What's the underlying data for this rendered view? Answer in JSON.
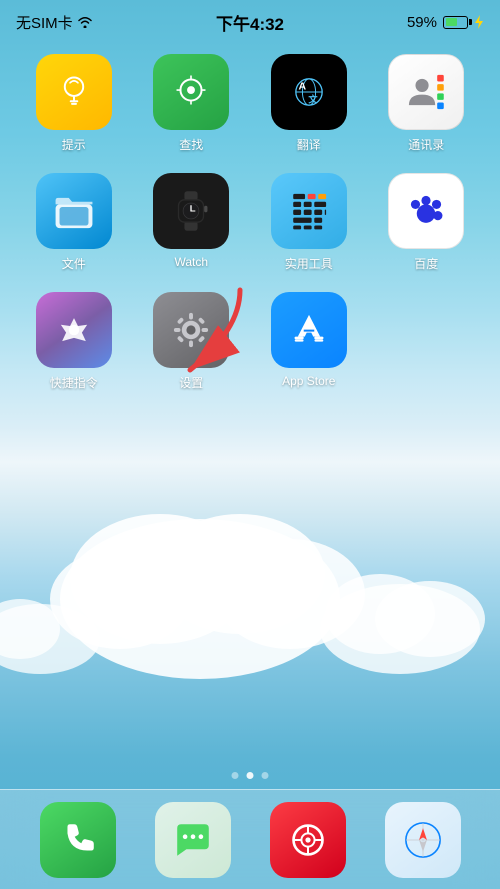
{
  "statusBar": {
    "carrier": "无SIM卡",
    "time": "下午4:32",
    "battery": "59%",
    "batteryCharging": true
  },
  "apps": [
    {
      "id": "tips",
      "label": "提示",
      "iconClass": "icon-tips"
    },
    {
      "id": "find",
      "label": "查找",
      "iconClass": "icon-find"
    },
    {
      "id": "translate",
      "label": "翻译",
      "iconClass": "icon-translate"
    },
    {
      "id": "contacts",
      "label": "通讯录",
      "iconClass": "icon-contacts"
    },
    {
      "id": "files",
      "label": "文件",
      "iconClass": "icon-files"
    },
    {
      "id": "watch",
      "label": "Watch",
      "iconClass": "icon-watch"
    },
    {
      "id": "utilities",
      "label": "实用工具",
      "iconClass": "icon-utilities"
    },
    {
      "id": "baidu",
      "label": "百度",
      "iconClass": "icon-baidu"
    },
    {
      "id": "shortcuts",
      "label": "快捷指令",
      "iconClass": "icon-shortcuts"
    },
    {
      "id": "settings",
      "label": "设置",
      "iconClass": "icon-settings"
    },
    {
      "id": "appstore",
      "label": "App Store",
      "iconClass": "icon-appstore"
    }
  ],
  "dock": [
    {
      "id": "phone",
      "label": "电话",
      "iconClass": "icon-phone"
    },
    {
      "id": "messages",
      "label": "信息",
      "iconClass": "icon-messages"
    },
    {
      "id": "music",
      "label": "音乐",
      "iconClass": "icon-music"
    },
    {
      "id": "safari",
      "label": "Safari",
      "iconClass": "icon-safari"
    }
  ],
  "pageIndicator": {
    "dots": [
      {
        "active": false
      },
      {
        "active": true
      },
      {
        "active": false
      }
    ]
  },
  "arrow": {
    "pointing": "settings"
  }
}
